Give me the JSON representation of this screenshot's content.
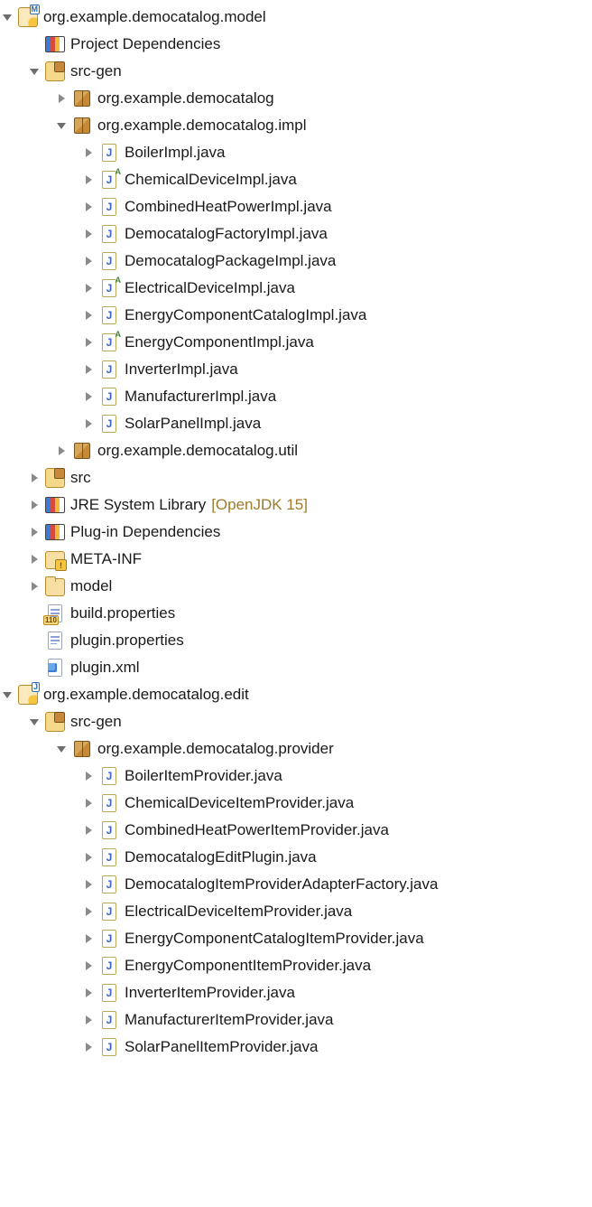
{
  "projects": [
    {
      "name": "org.example.democatalog.model",
      "type": "project-m",
      "expanded": true,
      "children": [
        {
          "name": "Project Dependencies",
          "type": "lib"
        },
        {
          "name": "src-gen",
          "type": "srcfolder",
          "expanded": true,
          "children": [
            {
              "name": "org.example.democatalog",
              "type": "package",
              "expanded": false,
              "hasChildren": true
            },
            {
              "name": "org.example.democatalog.impl",
              "type": "package",
              "expanded": true,
              "children": [
                {
                  "name": "BoilerImpl.java",
                  "type": "java"
                },
                {
                  "name": "ChemicalDeviceImpl.java",
                  "type": "java-abstract"
                },
                {
                  "name": "CombinedHeatPowerImpl.java",
                  "type": "java"
                },
                {
                  "name": "DemocatalogFactoryImpl.java",
                  "type": "java"
                },
                {
                  "name": "DemocatalogPackageImpl.java",
                  "type": "java"
                },
                {
                  "name": "ElectricalDeviceImpl.java",
                  "type": "java-abstract"
                },
                {
                  "name": "EnergyComponentCatalogImpl.java",
                  "type": "java"
                },
                {
                  "name": "EnergyComponentImpl.java",
                  "type": "java-abstract"
                },
                {
                  "name": "InverterImpl.java",
                  "type": "java"
                },
                {
                  "name": "ManufacturerImpl.java",
                  "type": "java"
                },
                {
                  "name": "SolarPanelImpl.java",
                  "type": "java"
                }
              ]
            },
            {
              "name": "org.example.democatalog.util",
              "type": "package",
              "expanded": false,
              "hasChildren": true
            }
          ]
        },
        {
          "name": "src",
          "type": "srcfolder",
          "expanded": false,
          "hasChildren": true
        },
        {
          "name": "JRE System Library",
          "type": "lib",
          "decor": "[OpenJDK 15]",
          "expanded": false,
          "hasChildren": true
        },
        {
          "name": "Plug-in Dependencies",
          "type": "lib",
          "expanded": false,
          "hasChildren": true
        },
        {
          "name": "META-INF",
          "type": "folder-warn",
          "expanded": false,
          "hasChildren": true
        },
        {
          "name": "model",
          "type": "folder",
          "expanded": false,
          "hasChildren": true
        },
        {
          "name": "build.properties",
          "type": "file-badge",
          "badge": "110"
        },
        {
          "name": "plugin.properties",
          "type": "file"
        },
        {
          "name": "plugin.xml",
          "type": "plugin"
        }
      ]
    },
    {
      "name": "org.example.democatalog.edit",
      "type": "project-j",
      "expanded": true,
      "children": [
        {
          "name": "src-gen",
          "type": "srcfolder",
          "expanded": true,
          "children": [
            {
              "name": "org.example.democatalog.provider",
              "type": "package",
              "expanded": true,
              "children": [
                {
                  "name": "BoilerItemProvider.java",
                  "type": "java"
                },
                {
                  "name": "ChemicalDeviceItemProvider.java",
                  "type": "java"
                },
                {
                  "name": "CombinedHeatPowerItemProvider.java",
                  "type": "java"
                },
                {
                  "name": "DemocatalogEditPlugin.java",
                  "type": "java"
                },
                {
                  "name": "DemocatalogItemProviderAdapterFactory.java",
                  "type": "java"
                },
                {
                  "name": "ElectricalDeviceItemProvider.java",
                  "type": "java"
                },
                {
                  "name": "EnergyComponentCatalogItemProvider.java",
                  "type": "java"
                },
                {
                  "name": "EnergyComponentItemProvider.java",
                  "type": "java"
                },
                {
                  "name": "InverterItemProvider.java",
                  "type": "java"
                },
                {
                  "name": "ManufacturerItemProvider.java",
                  "type": "java"
                },
                {
                  "name": "SolarPanelItemProvider.java",
                  "type": "java"
                }
              ]
            }
          ]
        }
      ]
    }
  ]
}
